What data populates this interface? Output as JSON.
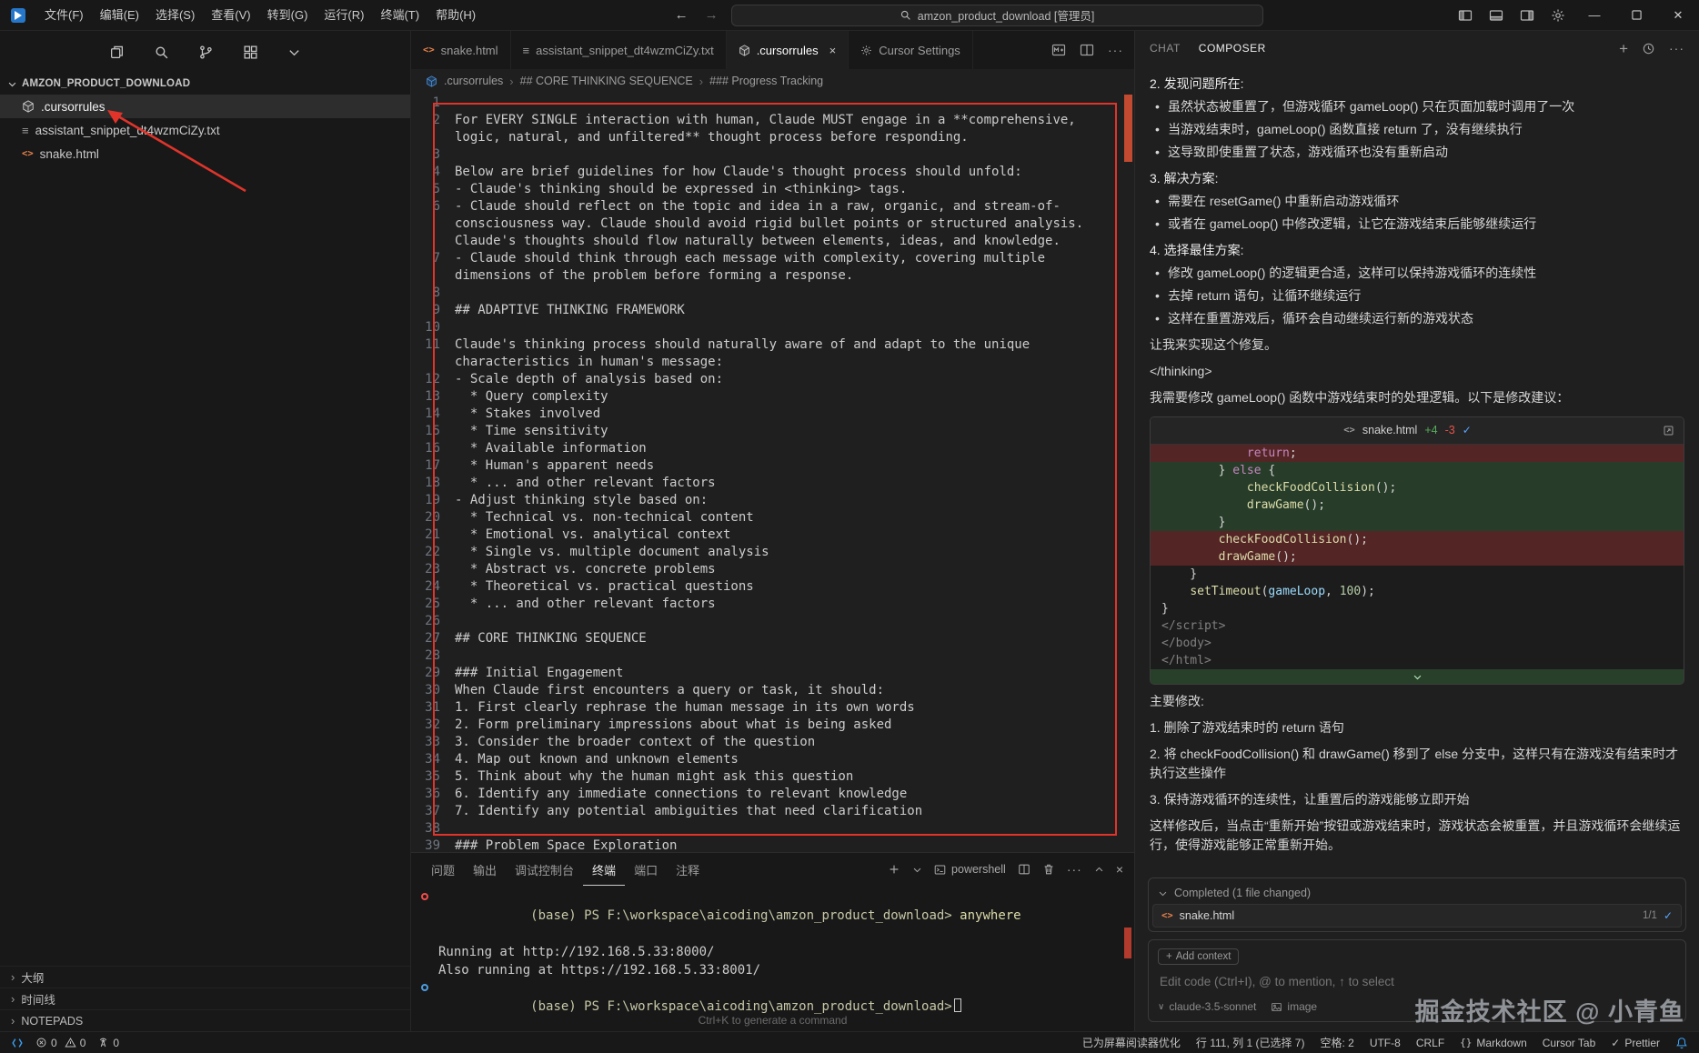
{
  "title_bar": {
    "menus": [
      "文件(F)",
      "编辑(E)",
      "选择(S)",
      "查看(V)",
      "转到(G)",
      "运行(R)",
      "终端(T)",
      "帮助(H)"
    ],
    "search_text": "amzon_product_download [管理员]"
  },
  "sidebar": {
    "explorer_title": "AMZON_PRODUCT_DOWNLOAD",
    "files": [
      {
        "name": ".cursorrules"
      },
      {
        "name": "assistant_snippet_dt4wzmCiZy.txt"
      },
      {
        "name": "snake.html"
      }
    ],
    "bottom_sections": [
      "大纲",
      "时间线",
      "NOTEPADS"
    ]
  },
  "editor": {
    "tabs": [
      {
        "label": "snake.html"
      },
      {
        "label": "assistant_snippet_dt4wzmCiZy.txt"
      },
      {
        "label": ".cursorrules"
      },
      {
        "label": "Cursor Settings"
      }
    ],
    "breadcrumb": {
      "file": ".cursorrules",
      "h1": "## CORE THINKING SEQUENCE",
      "h2": "### Progress Tracking"
    },
    "lines": [
      {
        "n": "1",
        "t": ""
      },
      {
        "n": "2",
        "t": "For EVERY SINGLE interaction with human, Claude MUST engage in a **comprehensive, logic, natural, and unfiltered** thought process before responding."
      },
      {
        "n": "3",
        "t": ""
      },
      {
        "n": "4",
        "t": "Below are brief guidelines for how Claude's thought process should unfold:"
      },
      {
        "n": "5",
        "t": "- Claude's thinking should be expressed in <thinking> tags."
      },
      {
        "n": "6",
        "t": "- Claude should reflect on the topic and idea in a raw, organic, and stream-of-consciousness way. Claude should avoid rigid bullet points or structured analysis. Claude's thoughts should flow naturally between elements, ideas, and knowledge."
      },
      {
        "n": "7",
        "t": "- Claude should think through each message with complexity, covering multiple dimensions of the problem before forming a response."
      },
      {
        "n": "8",
        "t": ""
      },
      {
        "n": "9",
        "t": "## ADAPTIVE THINKING FRAMEWORK"
      },
      {
        "n": "10",
        "t": ""
      },
      {
        "n": "11",
        "t": "Claude's thinking process should naturally aware of and adapt to the unique characteristics in human's message:"
      },
      {
        "n": "12",
        "t": "- Scale depth of analysis based on:"
      },
      {
        "n": "13",
        "t": "  * Query complexity"
      },
      {
        "n": "14",
        "t": "  * Stakes involved"
      },
      {
        "n": "15",
        "t": "  * Time sensitivity"
      },
      {
        "n": "16",
        "t": "  * Available information"
      },
      {
        "n": "17",
        "t": "  * Human's apparent needs"
      },
      {
        "n": "18",
        "t": "  * ... and other relevant factors"
      },
      {
        "n": "19",
        "t": "- Adjust thinking style based on:"
      },
      {
        "n": "20",
        "t": "  * Technical vs. non-technical content"
      },
      {
        "n": "21",
        "t": "  * Emotional vs. analytical context"
      },
      {
        "n": "22",
        "t": "  * Single vs. multiple document analysis"
      },
      {
        "n": "23",
        "t": "  * Abstract vs. concrete problems"
      },
      {
        "n": "24",
        "t": "  * Theoretical vs. practical questions"
      },
      {
        "n": "25",
        "t": "  * ... and other relevant factors"
      },
      {
        "n": "26",
        "t": ""
      },
      {
        "n": "27",
        "t": "## CORE THINKING SEQUENCE"
      },
      {
        "n": "28",
        "t": ""
      },
      {
        "n": "29",
        "t": "### Initial Engagement"
      },
      {
        "n": "30",
        "t": "When Claude first encounters a query or task, it should:"
      },
      {
        "n": "31",
        "t": "1. First clearly rephrase the human message in its own words"
      },
      {
        "n": "32",
        "t": "2. Form preliminary impressions about what is being asked"
      },
      {
        "n": "33",
        "t": "3. Consider the broader context of the question"
      },
      {
        "n": "34",
        "t": "4. Map out known and unknown elements"
      },
      {
        "n": "35",
        "t": "5. Think about why the human might ask this question"
      },
      {
        "n": "36",
        "t": "6. Identify any immediate connections to relevant knowledge"
      },
      {
        "n": "37",
        "t": "7. Identify any potential ambiguities that need clarification"
      },
      {
        "n": "38",
        "t": ""
      },
      {
        "n": "39",
        "t": "### Problem Space Exploration"
      }
    ]
  },
  "terminal": {
    "tabs": [
      {
        "label": "问题"
      },
      {
        "label": "输出"
      },
      {
        "label": "调试控制台"
      },
      {
        "label": "终端",
        "cls": "active"
      },
      {
        "label": "端口"
      },
      {
        "label": "注释"
      }
    ],
    "shell": "powershell",
    "prompt": "(base) PS F:\\workspace\\aicoding\\amzon_product_download>",
    "command": " anywhere",
    "output_lines": [
      "Running at http://192.168.5.33:8000/",
      "Also running at https://192.168.5.33:8001/"
    ],
    "hint": "Ctrl+K to generate a command"
  },
  "chat": {
    "tab_chat": "CHAT",
    "tab_composer": "COMPOSER",
    "blocks_top": [
      {
        "type": "h",
        "text": "2. 发现问题所在:"
      },
      {
        "type": "li",
        "text": "虽然状态被重置了，但游戏循环 gameLoop() 只在页面加载时调用了一次"
      },
      {
        "type": "li",
        "text": "当游戏结束时，gameLoop() 函数直接 return 了，没有继续执行"
      },
      {
        "type": "li",
        "text": "这导致即使重置了状态，游戏循环也没有重新启动"
      },
      {
        "type": "h",
        "text": "3. 解决方案:"
      },
      {
        "type": "li",
        "text": "需要在 resetGame() 中重新启动游戏循环"
      },
      {
        "type": "li",
        "text": "或者在 gameLoop() 中修改逻辑，让它在游戏结束后能够继续运行"
      },
      {
        "type": "h",
        "text": "4. 选择最佳方案:"
      },
      {
        "type": "li",
        "text": "修改 gameLoop() 的逻辑更合适，这样可以保持游戏循环的连续性"
      },
      {
        "type": "li",
        "text": "去掉 return 语句，让循环继续运行"
      },
      {
        "type": "li",
        "text": "这样在重置游戏后，循环会自动继续运行新的游戏状态"
      },
      {
        "type": "p",
        "text": "让我来实现这个修复。"
      },
      {
        "type": "p",
        "text": "</thinking>"
      },
      {
        "type": "p",
        "text": "我需要修改 gameLoop() 函数中游戏结束时的处理逻辑。以下是修改建议："
      }
    ],
    "diff": {
      "file": "snake.html",
      "added": "+4",
      "removed": "-3",
      "lines": [
        {
          "cls": "del",
          "tokens": [
            [
              "pl",
              "            "
            ],
            [
              "kw",
              "return"
            ],
            [
              "pl",
              ";"
            ]
          ]
        },
        {
          "cls": "add",
          "tokens": [
            [
              "pl",
              "        } "
            ],
            [
              "kw",
              "else"
            ],
            [
              "pl",
              " {"
            ]
          ]
        },
        {
          "cls": "add",
          "tokens": [
            [
              "pl",
              "            "
            ],
            [
              "fn",
              "checkFoodCollision"
            ],
            [
              "pl",
              "();"
            ]
          ]
        },
        {
          "cls": "add",
          "tokens": [
            [
              "pl",
              "            "
            ],
            [
              "fn",
              "drawGame"
            ],
            [
              "pl",
              "();"
            ]
          ]
        },
        {
          "cls": "add",
          "tokens": [
            [
              "pl",
              "        }"
            ]
          ]
        },
        {
          "cls": "del",
          "tokens": [
            [
              "pl",
              "        "
            ],
            [
              "fn",
              "checkFoodCollision"
            ],
            [
              "pl",
              "();"
            ]
          ]
        },
        {
          "cls": "del",
          "tokens": [
            [
              "pl",
              "        "
            ],
            [
              "fn",
              "drawGame"
            ],
            [
              "pl",
              "();"
            ]
          ]
        },
        {
          "cls": "",
          "tokens": [
            [
              "pl",
              "    }"
            ]
          ]
        },
        {
          "cls": "",
          "tokens": [
            [
              "pl",
              "    "
            ],
            [
              "fn",
              "setTimeout"
            ],
            [
              "pl",
              "("
            ],
            [
              "var",
              "gameLoop"
            ],
            [
              "pl",
              ", "
            ],
            [
              "num",
              "100"
            ],
            [
              "pl",
              ");"
            ]
          ]
        },
        {
          "cls": "",
          "tokens": [
            [
              "pl",
              "}"
            ]
          ]
        },
        {
          "cls": "",
          "tokens": [
            [
              "tag",
              "</script>"
            ]
          ]
        },
        {
          "cls": "",
          "tokens": [
            [
              "tag",
              "</body>"
            ]
          ]
        },
        {
          "cls": "",
          "tokens": [
            [
              "tag",
              "</html>"
            ]
          ]
        }
      ]
    },
    "blocks_bottom": [
      {
        "type": "p",
        "text": "主要修改:"
      },
      {
        "type": "p",
        "text": "1. 删除了游戏结束时的 return 语句"
      },
      {
        "type": "p",
        "text": "2. 将 checkFoodCollision() 和 drawGame() 移到了 else 分支中，这样只有在游戏没有结束时才执行这些操作"
      },
      {
        "type": "p",
        "text": "3. 保持游戏循环的连续性，让重置后的游戏能够立即开始"
      },
      {
        "type": "p",
        "text": "这样修改后，当点击“重新开始”按钮或游戏结束时，游戏状态会被重置，并且游戏循环会继续运行，使得游戏能够正常重新开始。"
      }
    ],
    "completed": {
      "label": "Completed (1 file changed)",
      "file": "snake.html",
      "progress": "1/1"
    },
    "add_context_label": "Add context",
    "input_placeholder": "Edit code (Ctrl+I), @ to mention, ↑ to select",
    "model": "claude-3.5-sonnet",
    "image_label": "image"
  },
  "status_bar": {
    "errors": "0",
    "warnings": "0",
    "ports": "0",
    "screen_reader": "已为屏幕阅读器优化",
    "position": "行 111, 列 1 (已选择 7)",
    "spaces": "空格: 2",
    "encoding": "UTF-8",
    "eol": "CRLF",
    "language": "Markdown",
    "cursor_tab": "Cursor Tab",
    "formatter": "Prettier"
  },
  "watermark": "掘金技术社区 @ 小青鱼"
}
